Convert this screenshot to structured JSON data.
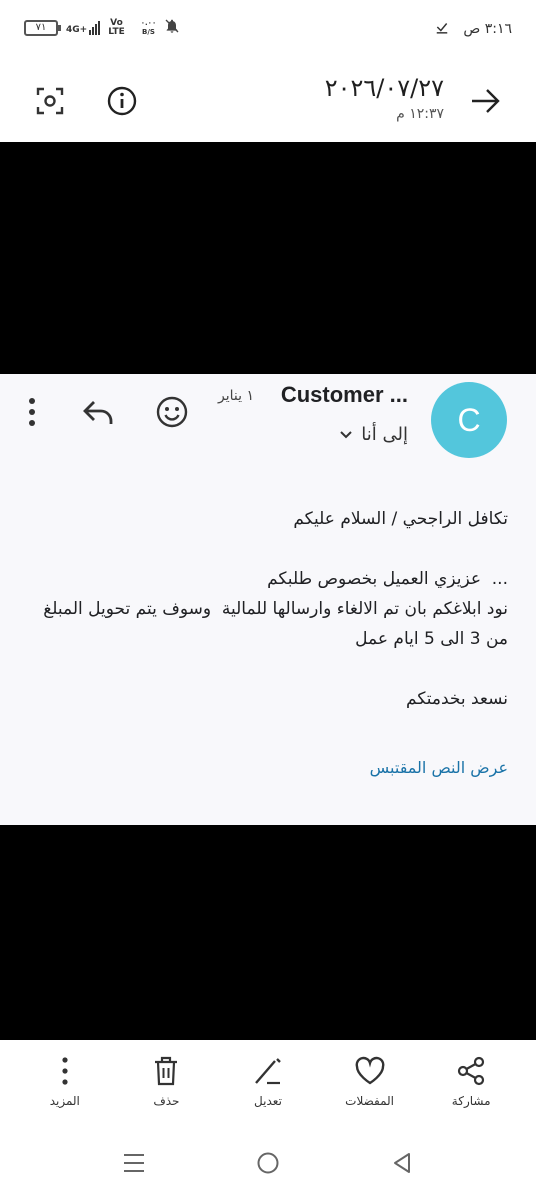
{
  "status_bar": {
    "battery": "٧١",
    "network": "4G+",
    "volte_top": "Vo",
    "volte_bottom": "LTE",
    "speed_top": "٠.٠٠",
    "speed_bottom": "B/S",
    "time": "٣:١٦ ص"
  },
  "header": {
    "date": "٢٠٢٦/٠٧/٢٧",
    "time": "١٢:٣٧ م",
    "icons": [
      "screen-capture-icon",
      "info-icon",
      "arrow-forward-icon"
    ]
  },
  "email": {
    "avatar_letter": "C",
    "avatar_color": "#53c6dc",
    "sender": "Customer ...",
    "date": "١ يناير",
    "to": "إلى أنا",
    "body": {
      "line1": "تكافل الراجحي / السلام عليكم",
      "line2": "...  عزيزي العميل بخصوص طلبكم",
      "line3": "نود ابلاغكم بان تم الالغاء وارسالها للمالية  وسوف يتم تحويل المبلغ",
      "line4": "من 3 الى 5 ايام عمل",
      "line5": "نسعد بخدمتكم"
    },
    "show_quoted": "عرض النص المقتبس",
    "link_color": "#1a73a8"
  },
  "actions": {
    "share": "مشاركة",
    "favorites": "المفضلات",
    "edit": "تعديل",
    "delete": "حذف",
    "more": "المزيد"
  }
}
